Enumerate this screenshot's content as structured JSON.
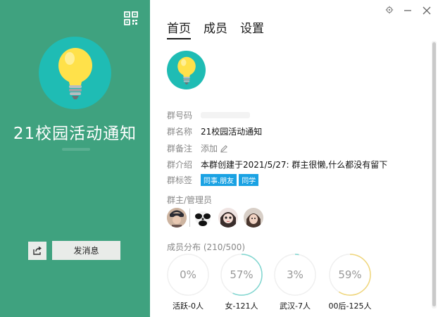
{
  "left": {
    "group_name": "21校园活动通知",
    "send_button": "发消息",
    "qr_icon": "qr-code-icon",
    "share_icon": "share-icon"
  },
  "window": {
    "settings_icon": "gear-icon",
    "minimize_icon": "minimize-icon",
    "close_icon": "close-icon"
  },
  "tabs": [
    "首页",
    "成员",
    "设置"
  ],
  "info": {
    "group_id_label": "群号码",
    "group_name_label": "群名称",
    "group_name_value": "21校园活动通知",
    "remark_label": "群备注",
    "remark_value": "添加",
    "intro_label": "群介绍",
    "intro_value": "本群创建于2021/5/27:  群主很懒,什么都没有留下",
    "tags_label": "群标签",
    "tags": [
      "同事.朋友",
      "同学"
    ]
  },
  "admins": {
    "title": "群主/管理员"
  },
  "distribution": {
    "title": "成员分布 (210/500)",
    "stats": [
      {
        "value": "0%",
        "label": "活跃-0人",
        "fraction": 0.0
      },
      {
        "value": "57%",
        "label": "女-121人",
        "fraction": 0.57
      },
      {
        "value": "3%",
        "label": "武汉-7人",
        "fraction": 0.03
      },
      {
        "value": "59%",
        "label": "00后-125人",
        "fraction": 0.59
      }
    ]
  },
  "colors": {
    "left_bg": "#3fa27f",
    "avatar_teal": "#1fbcb4",
    "bulb_yellow": "#ffe14a",
    "tag_blue": "#1aa2e3",
    "ring_teal": "#7fd6d0",
    "ring_yellow": "#f0d67a"
  }
}
